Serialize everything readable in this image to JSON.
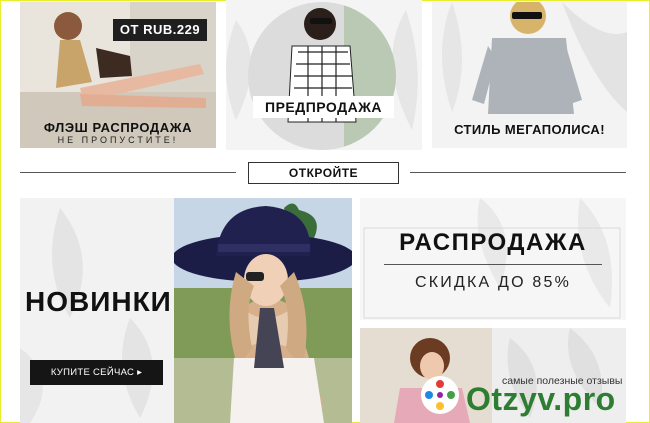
{
  "top_row": {
    "flash_sale": {
      "price_tag": "OT RUB.229",
      "title": "ФЛЭШ РАСПРОДАЖА",
      "subtitle": "НЕ ПРОПУСТИТЕ!"
    },
    "presale": {
      "title": "ПРЕДПРОДАЖА"
    },
    "metropolis": {
      "title": "СТИЛЬ МЕГАПОЛИСА!"
    }
  },
  "divider": {
    "button_label": "ОТКРОЙТЕ"
  },
  "new_arrivals": {
    "title": "НОВИНКИ",
    "button_label": "КУПИТЕ СЕЙЧАС ▸"
  },
  "sale": {
    "title": "РАСПРОДАЖА",
    "subtitle": "СКИДКА ДО 85%"
  },
  "watermark": {
    "tagline": "самые полезные отзывы",
    "brand": "Otzyv.pro"
  },
  "colors": {
    "frame": "#e8ef2a",
    "dark": "#151515",
    "brand_green": "#2e7d32"
  }
}
